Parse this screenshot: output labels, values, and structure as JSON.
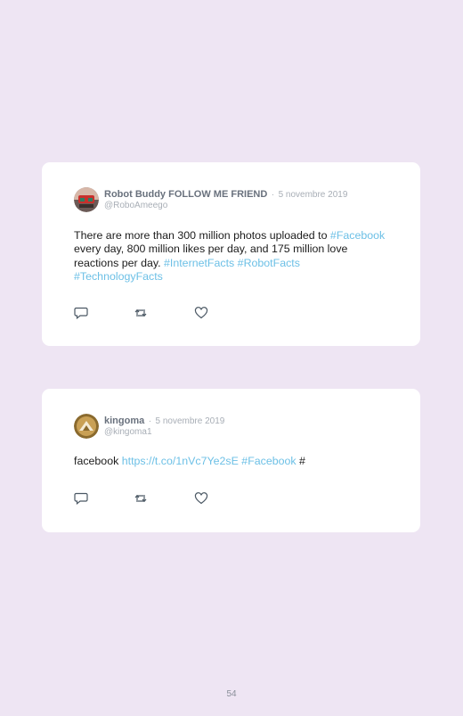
{
  "tweets": [
    {
      "name": "Robot Buddy FOLLOW ME FRIEND",
      "separator": "·",
      "date": "5 novembre 2019",
      "handle": "@RoboAmeego",
      "text_before": "There are more than 300 million photos uploaded to ",
      "tag_facebook": "#Facebook",
      "text_middle": " every day, 800 million likes per day, and 175 million love reactions per day. ",
      "tag_internet": "#InternetFacts",
      "tag_robot": "#RobotFacts",
      "tag_technology": "#TechnologyFacts"
    },
    {
      "name": "kingoma",
      "separator": "·",
      "date": "5 novembre 2019",
      "handle": "@kingoma1",
      "text_before": "facebook ",
      "link": "https://t.co/1nVc7Ye2sE",
      "tag_facebook": "#Facebook",
      "text_after": " #"
    }
  ],
  "icons": {
    "reply": "reply-icon",
    "retweet": "retweet-icon",
    "like": "heart-icon"
  },
  "colors": {
    "background": "#eee5f3",
    "link": "#6dc0e6",
    "name": "#69717d",
    "meta": "#a8aeb6"
  },
  "page_number": "54"
}
